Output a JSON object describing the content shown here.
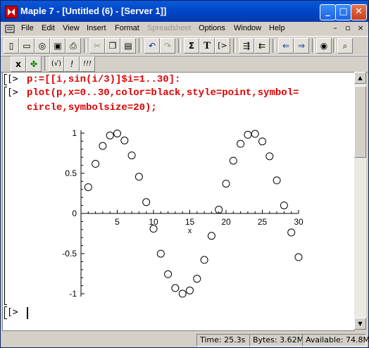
{
  "window": {
    "title": "Maple 7  - [Untitled (6) - [Server 1]]"
  },
  "menu": [
    "File",
    "Edit",
    "View",
    "Insert",
    "Format",
    "Spreadsheet",
    "Options",
    "Window",
    "Help"
  ],
  "menu_disabled": [
    "Spreadsheet"
  ],
  "toolbar1": {
    "icons": [
      "new-icon",
      "open-icon",
      "open-url-icon",
      "save-icon",
      "print-icon",
      "cut-icon",
      "copy-icon",
      "paste-icon",
      "undo-icon",
      "redo-icon",
      "sum-icon",
      "text-icon",
      "input-icon",
      "indent-icon",
      "outdent-icon",
      "back-icon",
      "forward-icon",
      "stop-icon",
      "zoom-icon"
    ],
    "labels": {
      "sum": "Σ",
      "text": "T",
      "input": "[>"
    }
  },
  "toolbar2": {
    "labels": {
      "x": "x",
      "parens": "(√)",
      "excl": "!",
      "excl3": "!!!"
    }
  },
  "worksheet": {
    "prompt": "[>",
    "line1": "p:=[[i,sin(i/3)]$i=1..30]:",
    "line2": "plot(p,x=0..30,color=black,style=point,symbol=",
    "line3": "circle,symbolsize=20);"
  },
  "chart_data": {
    "type": "scatter",
    "x": [
      1,
      2,
      3,
      4,
      5,
      6,
      7,
      8,
      9,
      10,
      11,
      12,
      13,
      14,
      15,
      16,
      17,
      18,
      19,
      20,
      21,
      22,
      23,
      24,
      25,
      26,
      27,
      28,
      29,
      30
    ],
    "y": [
      0.327,
      0.618,
      0.841,
      0.971,
      0.996,
      0.909,
      0.723,
      0.457,
      0.141,
      -0.19,
      -0.501,
      -0.757,
      -0.929,
      -0.999,
      -0.959,
      -0.813,
      -0.578,
      -0.279,
      0.047,
      0.371,
      0.657,
      0.867,
      0.98,
      0.991,
      0.897,
      0.712,
      0.412,
      0.1,
      -0.237,
      -0.544
    ],
    "xlim": [
      0,
      30
    ],
    "ylim": [
      -1,
      1
    ],
    "xticks": [
      "5",
      "10",
      "15",
      "20",
      "25",
      "30"
    ],
    "yticks": [
      "1",
      "0.5",
      "0",
      "-0.5",
      "-1"
    ],
    "xlabel": "x",
    "marker": "circle",
    "color": "#000000"
  },
  "status": {
    "time": "Time:  25.3s",
    "bytes": "Bytes: 3.62M",
    "available": "Available: 74.8M"
  }
}
